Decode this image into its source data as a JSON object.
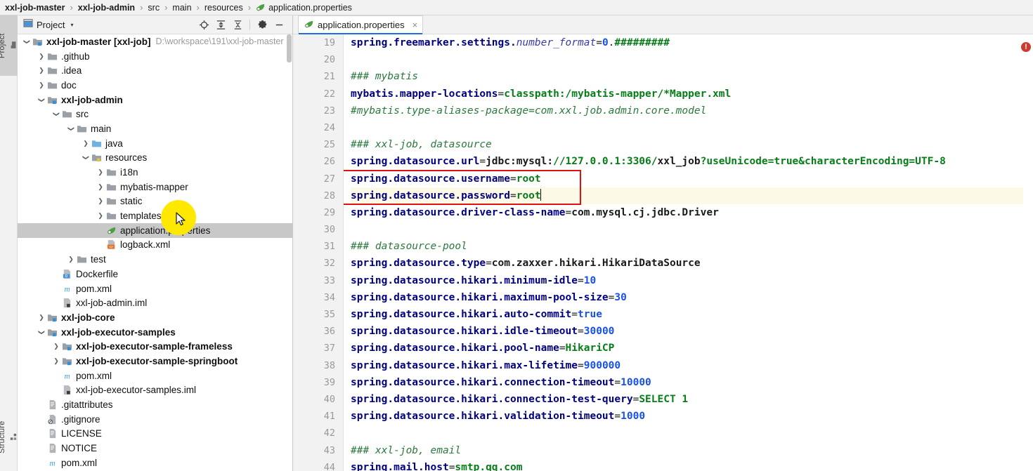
{
  "breadcrumb": {
    "name": "editor-breadcrumb",
    "items": [
      {
        "label": "xxl-job-master",
        "bold": true,
        "icon": ""
      },
      {
        "label": "xxl-job-admin",
        "bold": true,
        "icon": ""
      },
      {
        "label": "src",
        "bold": false,
        "icon": ""
      },
      {
        "label": "main",
        "bold": false,
        "icon": ""
      },
      {
        "label": "resources",
        "bold": false,
        "icon": ""
      },
      {
        "label": "application.properties",
        "bold": false,
        "icon": "spring-leaf-icon"
      }
    ],
    "separator": "›"
  },
  "toolstrip": {
    "project_tab": "Project",
    "structure_tab": "Structure"
  },
  "project_panel": {
    "title": "Project",
    "caret": "▾",
    "tools": [
      {
        "name": "locate-in-tree-icon",
        "glyph": "locate"
      },
      {
        "name": "expand-all-icon",
        "glyph": "expand"
      },
      {
        "name": "collapse-all-icon",
        "glyph": "collapse"
      },
      {
        "name": "settings-gear-icon",
        "glyph": "gear"
      },
      {
        "name": "hide-panel-icon",
        "glyph": "minus"
      }
    ],
    "tree": [
      {
        "indent": 0,
        "arrow": "down",
        "icon": "module",
        "label": "xxl-job-master [xxl-job]",
        "bold": true,
        "hint": "D:\\workspace\\191\\xxl-job-master"
      },
      {
        "indent": 1,
        "arrow": "right",
        "icon": "folder",
        "label": ".github",
        "bold": false,
        "hint": ""
      },
      {
        "indent": 1,
        "arrow": "right",
        "icon": "folder",
        "label": ".idea",
        "bold": false,
        "hint": ""
      },
      {
        "indent": 1,
        "arrow": "right",
        "icon": "folder",
        "label": "doc",
        "bold": false,
        "hint": ""
      },
      {
        "indent": 1,
        "arrow": "down",
        "icon": "module",
        "label": "xxl-job-admin",
        "bold": true,
        "hint": ""
      },
      {
        "indent": 2,
        "arrow": "down",
        "icon": "folder",
        "label": "src",
        "bold": false,
        "hint": ""
      },
      {
        "indent": 3,
        "arrow": "down",
        "icon": "folder",
        "label": "main",
        "bold": false,
        "hint": ""
      },
      {
        "indent": 4,
        "arrow": "right",
        "icon": "source-folder",
        "label": "java",
        "bold": false,
        "hint": ""
      },
      {
        "indent": 4,
        "arrow": "down",
        "icon": "resource-folder",
        "label": "resources",
        "bold": false,
        "hint": ""
      },
      {
        "indent": 5,
        "arrow": "right",
        "icon": "folder",
        "label": "i18n",
        "bold": false,
        "hint": ""
      },
      {
        "indent": 5,
        "arrow": "right",
        "icon": "folder",
        "label": "mybatis-mapper",
        "bold": false,
        "hint": ""
      },
      {
        "indent": 5,
        "arrow": "right",
        "icon": "folder",
        "label": "static",
        "bold": false,
        "hint": ""
      },
      {
        "indent": 5,
        "arrow": "right",
        "icon": "folder",
        "label": "templates",
        "bold": false,
        "hint": ""
      },
      {
        "indent": 5,
        "arrow": "none",
        "icon": "spring-leaf",
        "label": "application.properties",
        "bold": false,
        "hint": "",
        "selected": true
      },
      {
        "indent": 5,
        "arrow": "none",
        "icon": "xml-file",
        "label": "logback.xml",
        "bold": false,
        "hint": ""
      },
      {
        "indent": 3,
        "arrow": "right",
        "icon": "folder",
        "label": "test",
        "bold": false,
        "hint": ""
      },
      {
        "indent": 2,
        "arrow": "none",
        "icon": "docker-file",
        "label": "Dockerfile",
        "bold": false,
        "hint": ""
      },
      {
        "indent": 2,
        "arrow": "none",
        "icon": "maven-file",
        "label": "pom.xml",
        "bold": false,
        "hint": ""
      },
      {
        "indent": 2,
        "arrow": "none",
        "icon": "iml-file",
        "label": "xxl-job-admin.iml",
        "bold": false,
        "hint": ""
      },
      {
        "indent": 1,
        "arrow": "right",
        "icon": "module",
        "label": "xxl-job-core",
        "bold": true,
        "hint": ""
      },
      {
        "indent": 1,
        "arrow": "down",
        "icon": "module",
        "label": "xxl-job-executor-samples",
        "bold": true,
        "hint": ""
      },
      {
        "indent": 2,
        "arrow": "right",
        "icon": "module",
        "label": "xxl-job-executor-sample-frameless",
        "bold": true,
        "hint": ""
      },
      {
        "indent": 2,
        "arrow": "right",
        "icon": "module",
        "label": "xxl-job-executor-sample-springboot",
        "bold": true,
        "hint": ""
      },
      {
        "indent": 2,
        "arrow": "none",
        "icon": "maven-file",
        "label": "pom.xml",
        "bold": false,
        "hint": ""
      },
      {
        "indent": 2,
        "arrow": "none",
        "icon": "iml-file",
        "label": "xxl-job-executor-samples.iml",
        "bold": false,
        "hint": ""
      },
      {
        "indent": 1,
        "arrow": "none",
        "icon": "text-file",
        "label": ".gitattributes",
        "bold": false,
        "hint": ""
      },
      {
        "indent": 1,
        "arrow": "none",
        "icon": "gitignore-file",
        "label": ".gitignore",
        "bold": false,
        "hint": ""
      },
      {
        "indent": 1,
        "arrow": "none",
        "icon": "text-file",
        "label": "LICENSE",
        "bold": false,
        "hint": ""
      },
      {
        "indent": 1,
        "arrow": "none",
        "icon": "text-file",
        "label": "NOTICE",
        "bold": false,
        "hint": ""
      },
      {
        "indent": 1,
        "arrow": "none",
        "icon": "maven-file",
        "label": "pom.xml",
        "bold": false,
        "hint": ""
      }
    ]
  },
  "editor": {
    "tab": {
      "label": "application.properties",
      "icon": "spring-leaf-icon",
      "close": "×",
      "active": true
    },
    "first_line_number": 19,
    "caret_line_number": 28,
    "error_badge": "!",
    "lines": [
      {
        "num": 19,
        "tokens": [
          {
            "t": "k",
            "s": "spring.freemarker.settings."
          },
          {
            "t": "ki",
            "s": "number_format"
          },
          {
            "t": "eq",
            "s": "="
          },
          {
            "t": "n",
            "s": "0"
          },
          {
            "t": "eq",
            "s": "."
          },
          {
            "t": "v",
            "s": "#########"
          }
        ]
      },
      {
        "num": 20,
        "tokens": []
      },
      {
        "num": 21,
        "tokens": [
          {
            "t": "cm",
            "s": "### mybatis"
          }
        ]
      },
      {
        "num": 22,
        "tokens": [
          {
            "t": "k",
            "s": "mybatis.mapper-locations"
          },
          {
            "t": "eq",
            "s": "="
          },
          {
            "t": "v",
            "s": "classpath:/mybatis-mapper/*Mapper.xml"
          }
        ]
      },
      {
        "num": 23,
        "tokens": [
          {
            "t": "cm",
            "s": "#mybatis.type-aliases-package=com.xxl.job.admin.core.model"
          }
        ]
      },
      {
        "num": 24,
        "tokens": []
      },
      {
        "num": 25,
        "tokens": [
          {
            "t": "cm",
            "s": "### xxl-job, datasource"
          }
        ]
      },
      {
        "num": 26,
        "tokens": [
          {
            "t": "k",
            "s": "spring.datasource.url"
          },
          {
            "t": "eq",
            "s": "="
          },
          {
            "t": "vp",
            "s": "jdbc:mysql:"
          },
          {
            "t": "v",
            "s": "//127.0.0.1:3306/"
          },
          {
            "t": "vp",
            "s": "xxl_job"
          },
          {
            "t": "v",
            "s": "?useUnicode=true&characterEncoding=UTF-8"
          }
        ]
      },
      {
        "num": 27,
        "boxed": true,
        "tokens": [
          {
            "t": "k",
            "s": "spring.datasource.username"
          },
          {
            "t": "eq",
            "s": "="
          },
          {
            "t": "v",
            "s": "root"
          }
        ]
      },
      {
        "num": 28,
        "boxed": true,
        "caret": true,
        "tokens": [
          {
            "t": "k",
            "s": "spring.datasource.password"
          },
          {
            "t": "eq",
            "s": "="
          },
          {
            "t": "v",
            "s": "root"
          }
        ]
      },
      {
        "num": 29,
        "tokens": [
          {
            "t": "k",
            "s": "spring.datasource.driver-class-name"
          },
          {
            "t": "eq",
            "s": "="
          },
          {
            "t": "vp",
            "s": "com.mysql.cj.jdbc.Driver"
          }
        ]
      },
      {
        "num": 30,
        "tokens": []
      },
      {
        "num": 31,
        "tokens": [
          {
            "t": "cm",
            "s": "### datasource-pool"
          }
        ]
      },
      {
        "num": 32,
        "tokens": [
          {
            "t": "k",
            "s": "spring.datasource.type"
          },
          {
            "t": "eq",
            "s": "="
          },
          {
            "t": "vp",
            "s": "com.zaxxer.hikari.HikariDataSource"
          }
        ]
      },
      {
        "num": 33,
        "tokens": [
          {
            "t": "k",
            "s": "spring.datasource.hikari.minimum-idle"
          },
          {
            "t": "eq",
            "s": "="
          },
          {
            "t": "n",
            "s": "10"
          }
        ]
      },
      {
        "num": 34,
        "tokens": [
          {
            "t": "k",
            "s": "spring.datasource.hikari.maximum-pool-size"
          },
          {
            "t": "eq",
            "s": "="
          },
          {
            "t": "n",
            "s": "30"
          }
        ]
      },
      {
        "num": 35,
        "tokens": [
          {
            "t": "k",
            "s": "spring.datasource.hikari.auto-commit"
          },
          {
            "t": "eq",
            "s": "="
          },
          {
            "t": "n",
            "s": "true"
          }
        ]
      },
      {
        "num": 36,
        "tokens": [
          {
            "t": "k",
            "s": "spring.datasource.hikari.idle-timeout"
          },
          {
            "t": "eq",
            "s": "="
          },
          {
            "t": "n",
            "s": "30000"
          }
        ]
      },
      {
        "num": 37,
        "tokens": [
          {
            "t": "k",
            "s": "spring.datasource.hikari.pool-name"
          },
          {
            "t": "eq",
            "s": "="
          },
          {
            "t": "v",
            "s": "HikariCP"
          }
        ]
      },
      {
        "num": 38,
        "tokens": [
          {
            "t": "k",
            "s": "spring.datasource.hikari.max-lifetime"
          },
          {
            "t": "eq",
            "s": "="
          },
          {
            "t": "n",
            "s": "900000"
          }
        ]
      },
      {
        "num": 39,
        "tokens": [
          {
            "t": "k",
            "s": "spring.datasource.hikari.connection-timeout"
          },
          {
            "t": "eq",
            "s": "="
          },
          {
            "t": "n",
            "s": "10000"
          }
        ]
      },
      {
        "num": 40,
        "tokens": [
          {
            "t": "k",
            "s": "spring.datasource.hikari.connection-test-query"
          },
          {
            "t": "eq",
            "s": "="
          },
          {
            "t": "v",
            "s": "SELECT 1"
          }
        ]
      },
      {
        "num": 41,
        "tokens": [
          {
            "t": "k",
            "s": "spring.datasource.hikari.validation-timeout"
          },
          {
            "t": "eq",
            "s": "="
          },
          {
            "t": "n",
            "s": "1000"
          }
        ]
      },
      {
        "num": 42,
        "tokens": []
      },
      {
        "num": 43,
        "tokens": [
          {
            "t": "cm",
            "s": "### xxl-job, email"
          }
        ]
      },
      {
        "num": 44,
        "tokens": [
          {
            "t": "k",
            "s": "spring.mail.host"
          },
          {
            "t": "eq",
            "s": "="
          },
          {
            "t": "v",
            "s": "smtp.qq.com"
          }
        ]
      }
    ]
  },
  "annotation": {
    "redbox_color": "#e0120f",
    "caret_line_color": "#fcfae6",
    "click_highlight_color": "#ffe800"
  }
}
